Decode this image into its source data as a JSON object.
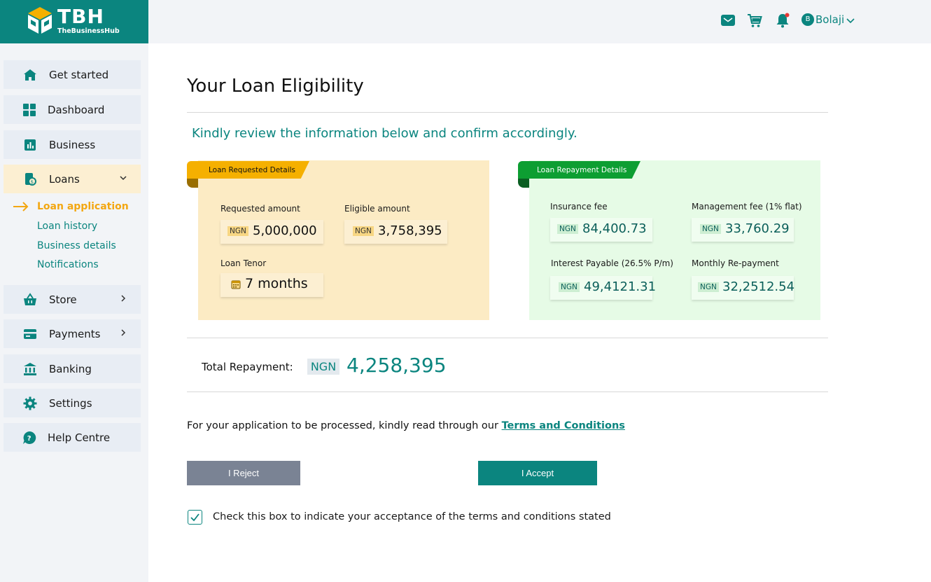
{
  "brand": {
    "name": "TBH",
    "tagline": "TheBusinessHub",
    "color": "#0b857f"
  },
  "topbar": {
    "icons": [
      "mail-icon",
      "cart-icon",
      "bell-icon"
    ],
    "user_initial": "B",
    "user_name": "Bolaji"
  },
  "sidebar": {
    "items": [
      {
        "label": "Get started",
        "icon": "home-icon"
      },
      {
        "label": "Dashboard",
        "icon": "grid-icon"
      },
      {
        "label": "Business",
        "icon": "chart-icon"
      },
      {
        "label": "Loans",
        "icon": "loan-icon"
      },
      {
        "label": "Store",
        "icon": "basket-icon"
      },
      {
        "label": "Payments",
        "icon": "card-icon"
      },
      {
        "label": "Banking",
        "icon": "bank-icon"
      },
      {
        "label": "Settings",
        "icon": "gear-icon"
      },
      {
        "label": "Help Centre",
        "icon": "help-icon"
      }
    ],
    "loan_subitems": [
      "Loan application",
      "Loan history",
      "Business details",
      "Notifications"
    ]
  },
  "main": {
    "title": "Your Loan Eligibility",
    "subtitle": "Kindly review the information below and confirm accordingly.",
    "requested": {
      "tab": "Loan Requested Details",
      "requested_label": "Requested amount",
      "requested_currency": "NGN",
      "requested_value": "5,000,000",
      "eligible_label": "Eligible amount",
      "eligible_currency": "NGN",
      "eligible_value": "3,758,395",
      "tenor_label": "Loan Tenor",
      "tenor_value": "7 months"
    },
    "repayment": {
      "tab": "Loan Repayment Details",
      "insurance_label": "Insurance fee",
      "insurance_currency": "NGN",
      "insurance_value": "84,400.73",
      "management_label": "Management fee (1% flat)",
      "management_currency": "NGN",
      "management_value": "33,760.29",
      "interest_label": "Interest Payable (26.5% P/m)",
      "interest_currency": "NGN",
      "interest_value": "49,4121.31",
      "monthly_label": "Monthly Re-payment",
      "monthly_currency": "NGN",
      "monthly_value": "32,2512.54"
    },
    "total": {
      "label": "Total Repayment:",
      "currency": "NGN",
      "value": "4,258,395"
    },
    "terms_text": "For your application to be processed, kindly read through our ",
    "terms_link": "Terms and Conditions",
    "reject_label": "I Reject",
    "accept_label": "I Accept",
    "checkbox_label": "Check this box to indicate your acceptance of the terms and conditions stated",
    "checkbox_checked": true
  }
}
